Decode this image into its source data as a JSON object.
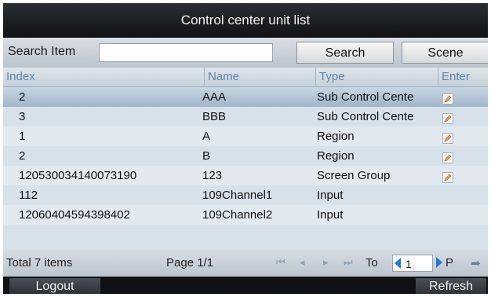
{
  "window": {
    "title": "Control center unit list"
  },
  "search": {
    "label": "Search Item",
    "value": "",
    "placeholder": "",
    "search_label": "Search",
    "scene_label": "Scene"
  },
  "table": {
    "headers": [
      "Index",
      "Name",
      "Type",
      "Enter"
    ],
    "rows": [
      {
        "index": "2",
        "name": "AAA",
        "type": "Sub Control Cente",
        "enter_icon": "edit-icon",
        "selected": true
      },
      {
        "index": "3",
        "name": "BBB",
        "type": "Sub Control Cente",
        "enter_icon": "edit-icon"
      },
      {
        "index": "1",
        "name": "A",
        "type": "Region",
        "enter_icon": "edit-icon"
      },
      {
        "index": "2",
        "name": "B",
        "type": "Region",
        "enter_icon": "edit-icon"
      },
      {
        "index": "120530034140073190",
        "name": "123",
        "type": "Screen Group",
        "enter_icon": "edit-icon"
      },
      {
        "index": "112",
        "name": "109Channel1",
        "type": "Input",
        "enter_icon": ""
      },
      {
        "index": "12060404594398402",
        "name": "109Channel2",
        "type": "Input",
        "enter_icon": ""
      }
    ]
  },
  "footer": {
    "total": "Total 7 items",
    "page": "Page 1/1",
    "nav_first": "⏮",
    "nav_prev": "◂",
    "nav_next": "▸",
    "nav_last": "⏭",
    "to_label": "To",
    "page_input": "1",
    "p_label": "P",
    "go": "➡"
  },
  "bottom": {
    "logout": "Logout",
    "refresh": "Refresh"
  },
  "colors": {
    "title_bg": "#101214",
    "selected_row": "#9fb5ca",
    "header_text": "#5b86ad",
    "accent": "#1e7ad6"
  }
}
